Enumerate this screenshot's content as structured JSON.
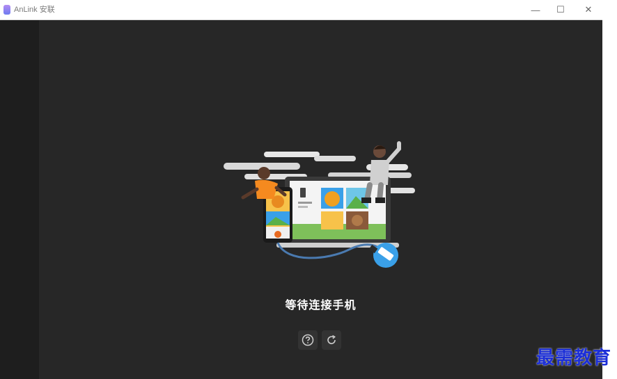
{
  "window": {
    "title": "AnLink 安联",
    "controls": {
      "minimize": "—",
      "maximize": "☐",
      "close": "✕"
    }
  },
  "main": {
    "status_text": "等待连接手机",
    "actions": [
      {
        "name": "help",
        "icon": "question-circle-icon"
      },
      {
        "name": "refresh",
        "icon": "refresh-icon"
      }
    ]
  },
  "watermark": "最需教育",
  "colors": {
    "background": "#272727",
    "sidebar": "#1e1e1e",
    "accent_blue": "#3aa0e8",
    "watermark": "#1c2fd8"
  }
}
